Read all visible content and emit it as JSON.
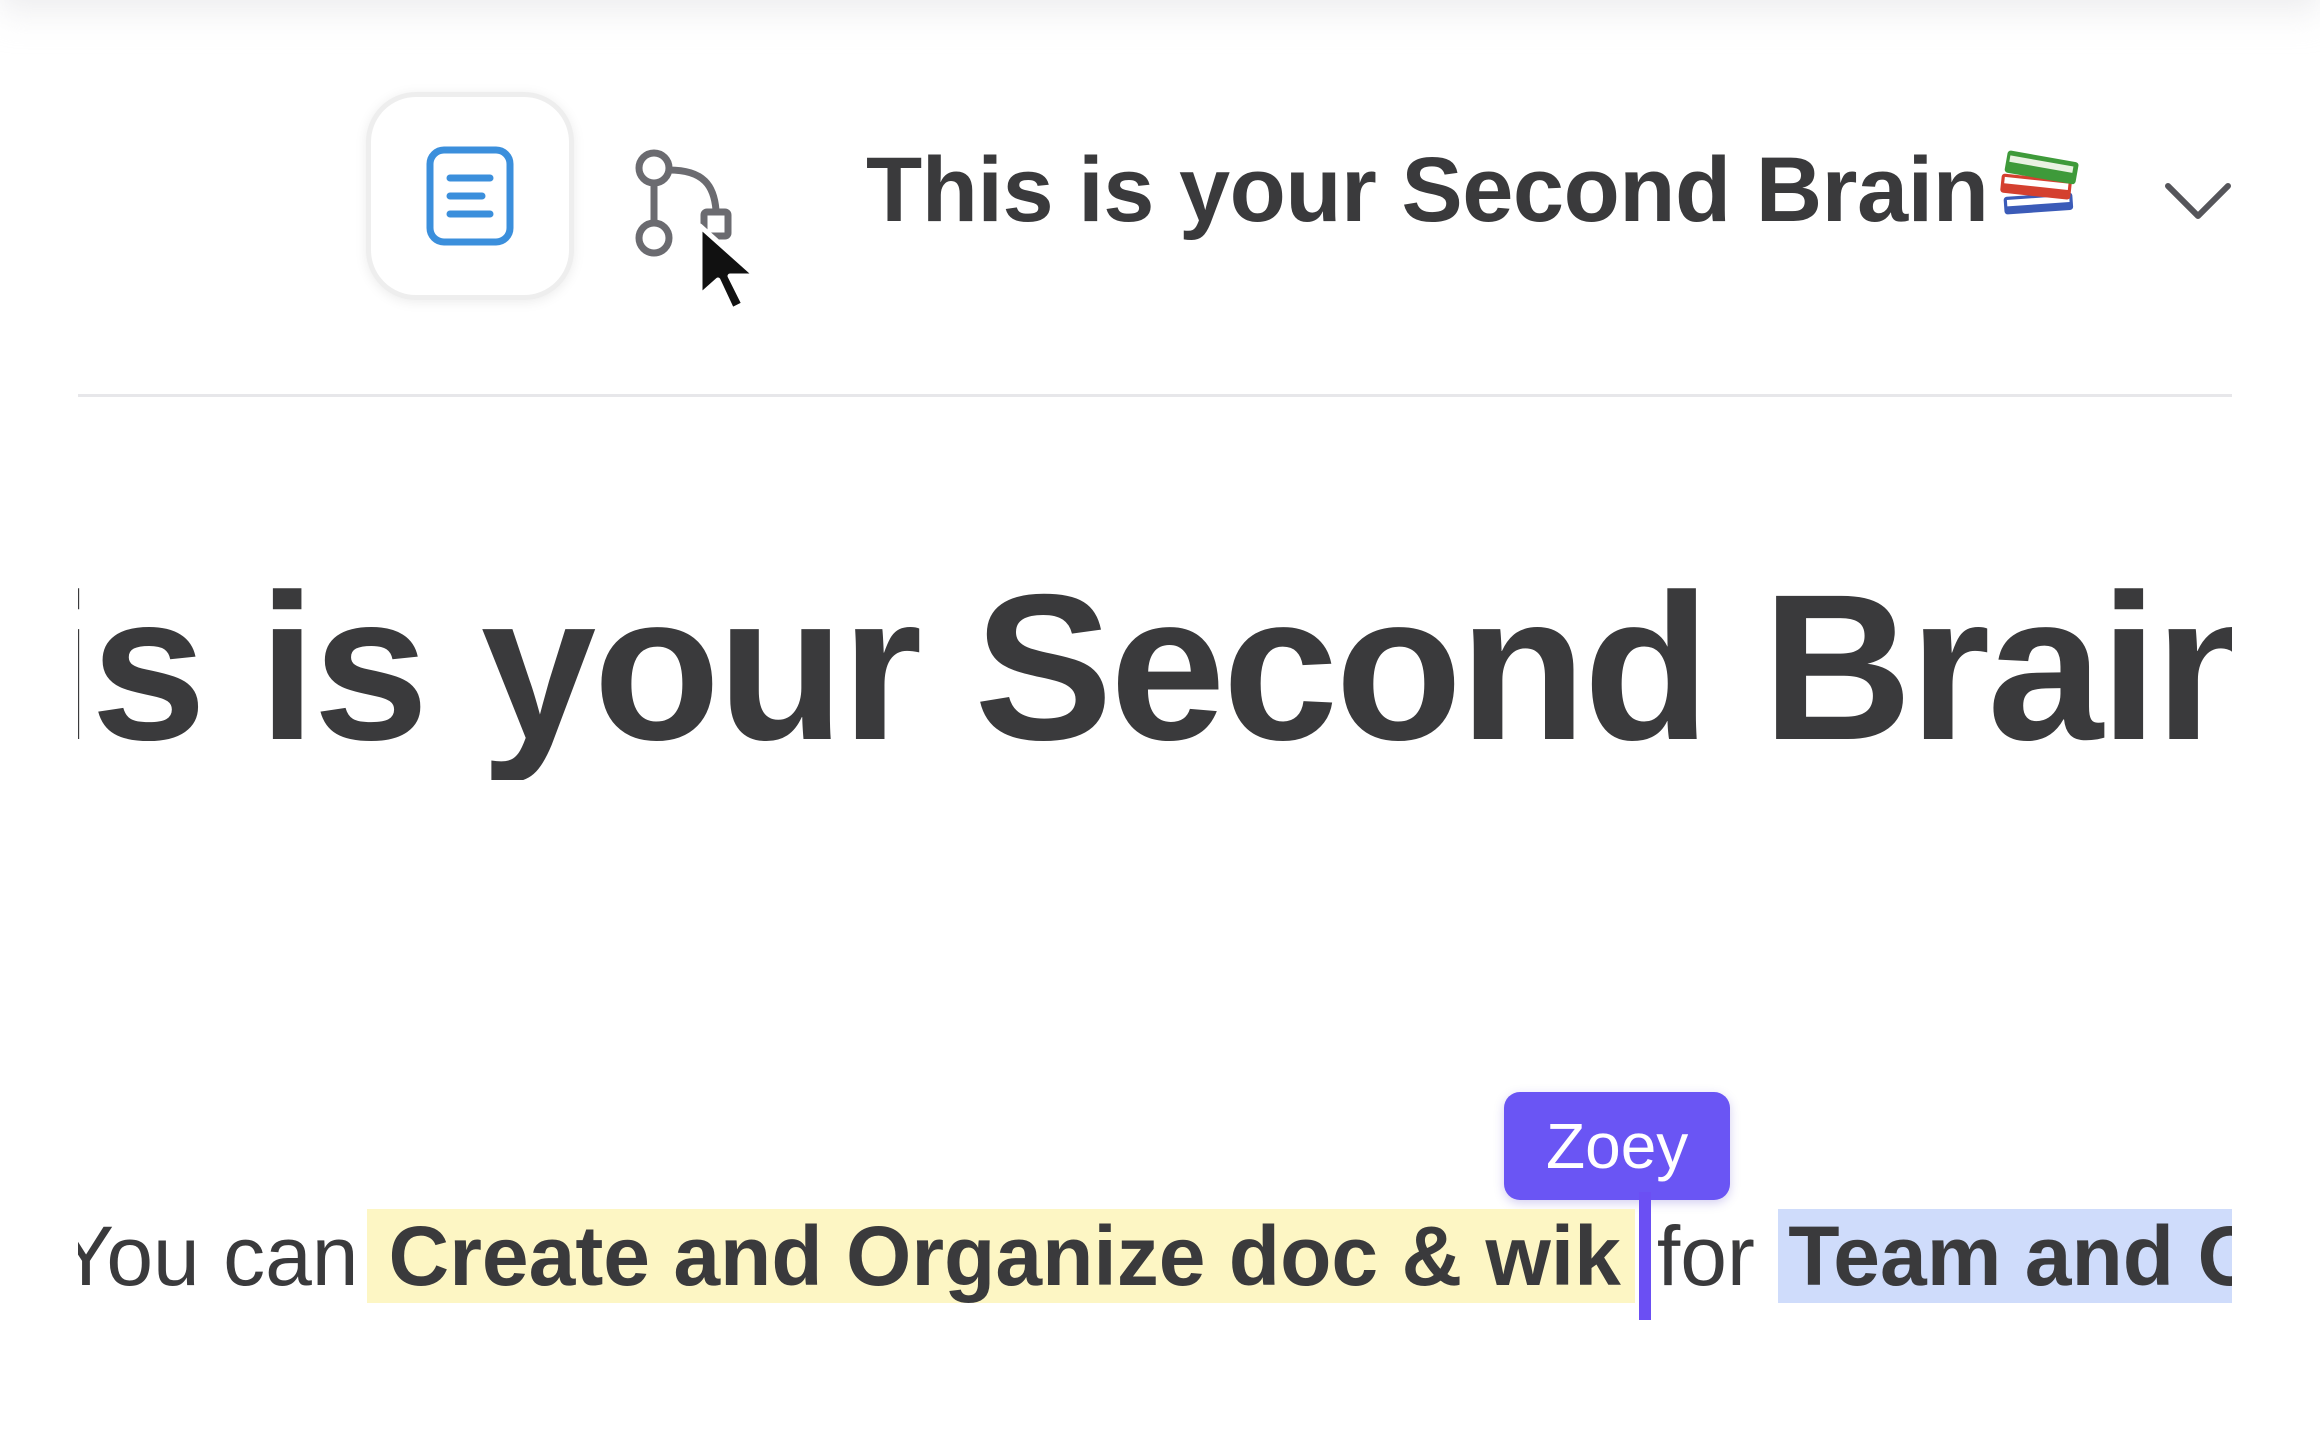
{
  "topbar": {
    "doc_title": "This is your Second Brain"
  },
  "editor": {
    "heading": "This is your Second Brain",
    "paragraph": {
      "before": "You can",
      "highlight_yellow": "Create and Organize doc & wik",
      "middle": "for",
      "highlight_blue": "Team and Org"
    },
    "collaborator_cursor": {
      "name": "Zoey"
    }
  },
  "icons": {
    "doc_view": "document-icon",
    "graph_view": "graph-branch-icon",
    "title_emoji": "books-emoji-icon",
    "dropdown": "chevron-down-icon",
    "pointer": "mouse-pointer-icon"
  },
  "colors": {
    "accent_blue": "#3b8fdc",
    "collaborator_purple": "#6a55f4",
    "highlight_yellow": "#fdf6c4",
    "highlight_blue": "#cfdcfb",
    "text": "#3a3a3c"
  }
}
